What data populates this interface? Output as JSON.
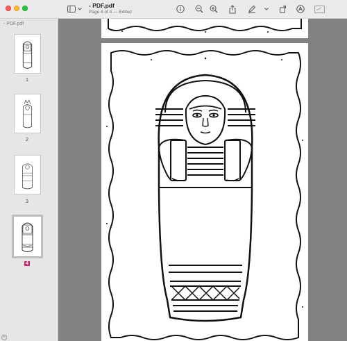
{
  "window": {
    "title": "- PDF.pdf",
    "subtitle": "Page 4 of 4 — Edited"
  },
  "sidebar": {
    "file_label": "- PDF.pdf",
    "thumbnails": [
      {
        "label": "1"
      },
      {
        "label": "2"
      },
      {
        "label": "3"
      },
      {
        "label": "4",
        "selected": true
      }
    ]
  },
  "toolbar": {
    "icons": [
      "sidebar-toggle-icon",
      "chevron-down-icon",
      "info-icon",
      "zoom-out-icon",
      "zoom-in-icon",
      "share-icon",
      "markup-pen-icon",
      "chevron-down-icon",
      "rotate-icon",
      "annotate-icon",
      "redact-icon"
    ]
  },
  "colors": {
    "accent": "#c9246a",
    "viewer_bg": "#828282",
    "sidebar_bg": "#e7e6e7",
    "toolbar_bg": "#eceaec"
  }
}
